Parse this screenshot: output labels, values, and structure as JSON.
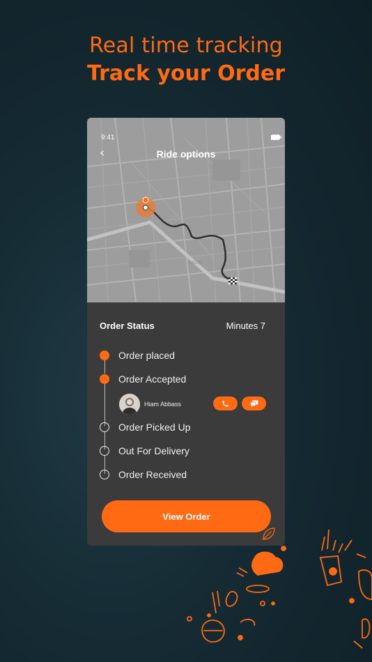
{
  "headline": {
    "line1": "Real time tracking",
    "line2": "Track your Order"
  },
  "phone": {
    "status_bar": {
      "time": "9:41"
    },
    "nav": {
      "back": "‹",
      "title": "Ride options"
    },
    "order_status": {
      "title": "Order Status",
      "minutes": "Minutes 7",
      "steps": [
        {
          "label": "Order placed",
          "state": "done"
        },
        {
          "label": "Order Accepted",
          "state": "done"
        },
        {
          "label": "Order Picked Up",
          "state": "pending"
        },
        {
          "label": "Out For Delivery",
          "state": "pending"
        },
        {
          "label": "Order Received",
          "state": "pending"
        }
      ],
      "driver": {
        "name": "Hiam Abbass"
      }
    },
    "view_order_label": "View Order"
  },
  "colors": {
    "accent": "#ff6a13",
    "panel": "#3b3b3b",
    "map": "#9d9d9d",
    "background": "#152a33"
  },
  "icons": [
    "back-icon",
    "signal-icon",
    "wifi-icon",
    "battery-icon",
    "pickup-pin-icon",
    "destination-flag-icon",
    "phone-icon",
    "chat-icon",
    "leaf-icon"
  ]
}
